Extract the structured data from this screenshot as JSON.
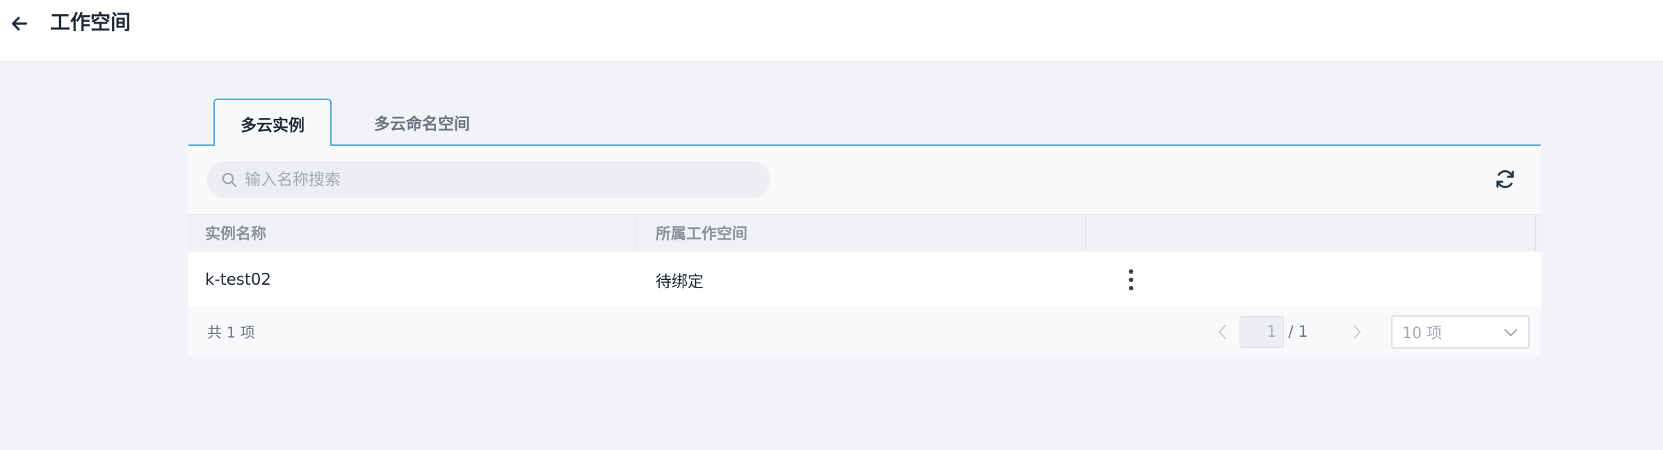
{
  "header": {
    "title": "工作空间",
    "back_icon": "arrow-left-icon"
  },
  "tabs": [
    {
      "label": "多云实例",
      "active": true
    },
    {
      "label": "多云命名空间",
      "active": false
    }
  ],
  "search": {
    "placeholder": "输入名称搜索",
    "value": "",
    "icon": "search-icon"
  },
  "toolbar": {
    "refresh_icon": "refresh-icon"
  },
  "table": {
    "columns": [
      "实例名称",
      "所属工作空间",
      ""
    ],
    "rows": [
      {
        "name": "k-test02",
        "workspace": "待绑定",
        "actions_icon": "more-vertical-icon"
      }
    ]
  },
  "pagination": {
    "total_text": "共 1 项",
    "current_page": "1",
    "total_pages_text": "/ 1",
    "page_size": "10 项"
  },
  "colors": {
    "accent": "#4fa8d8",
    "page_bg": "#f1f3f6",
    "header_bg": "#ffffff",
    "toolbar_bg": "#f7f9fb"
  }
}
